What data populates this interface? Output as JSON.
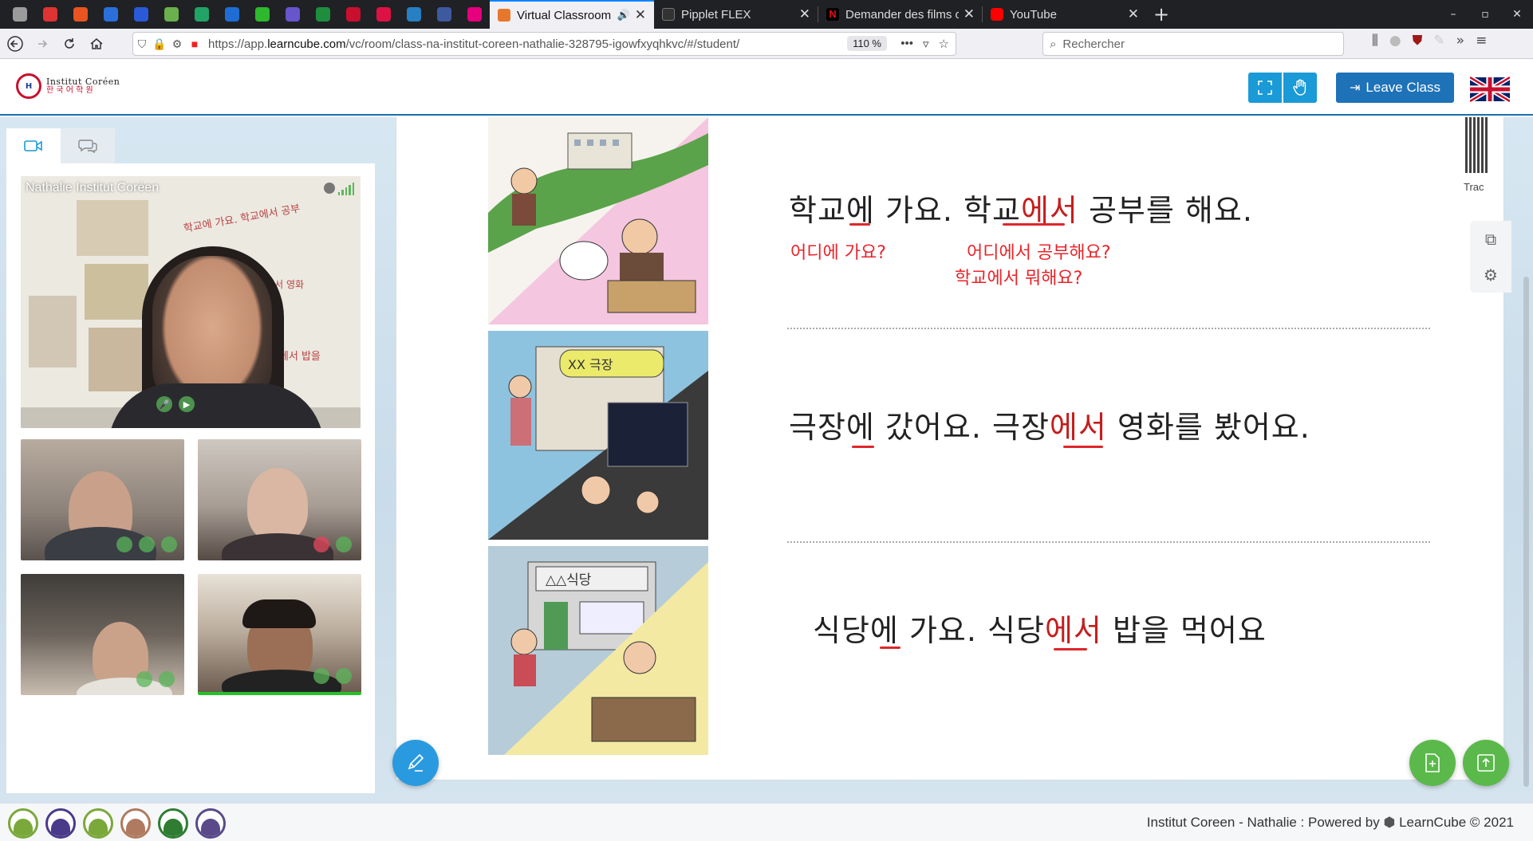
{
  "browser": {
    "tabs": [
      {
        "title": "Virtual Classroom | Le",
        "active": true,
        "favicon_color": "#e8772e"
      },
      {
        "title": "Pipplet FLEX",
        "active": false,
        "favicon_color": "#333333"
      },
      {
        "title": "Demander des films ou d",
        "active": false,
        "favicon_color": "#e50914"
      },
      {
        "title": "YouTube",
        "active": false,
        "favicon_color": "#ff0000"
      }
    ],
    "pinned_icons": [
      "#9b9b9b",
      "#d33",
      "#e95420",
      "#2a6fdb",
      "#2a5ad8",
      "#6ab04c",
      "#21a366",
      "#1f6dd4",
      "#2eb82e",
      "#6655cc",
      "#1e8e3e",
      "#c8102e",
      "#d14",
      "#2680c2",
      "#3d5a9e",
      "#e6007e"
    ],
    "url_prefix": "https://app.",
    "url_domain": "learncube.com",
    "url_path": "/vc/room/class-na-institut-coreen-nathalie-328795-igowfxyqhkvc/#/student/",
    "zoom": "110 %",
    "search_placeholder": "Rechercher",
    "new_tab": "+"
  },
  "header": {
    "logo_title": "Institut Coréen",
    "logo_sub": "한 국 어 학 원",
    "leave_label": "Leave Class"
  },
  "participants": {
    "main_name": "Nathalie Institut Coréen"
  },
  "board": {
    "sentence1": {
      "a": "학교에 가요. 학교",
      "hl": "에서",
      "b": " 공부를 해요."
    },
    "q1": "어디에 가요?",
    "q2": "어디에서 공부해요?",
    "q3": "학교에서 뭐해요?",
    "sentence2": {
      "a": "극장에 갔어요. 극장",
      "hl": "에서",
      "b": " 영화를 봤어요."
    },
    "sentence3": {
      "a": "식당에 가요. 식당",
      "hl": "에서",
      "b": " 밥을 먹어요"
    },
    "trac_label": "Trac",
    "sign1": "XX 극장",
    "sign2": "△△식당"
  },
  "footer": {
    "text": "Institut Coreen - Nathalie : Powered by",
    "brand": "LearnCube © 2021",
    "avatar_colors": [
      "#7aa83a",
      "#4a3a8a",
      "#7aa83a",
      "#b07a60",
      "#2e7d32",
      "#5a4a8a"
    ]
  },
  "colors": {
    "accent": "#1a9ad6",
    "leave_button": "#1d72b8",
    "highlight_red": "#e8242a",
    "green_button": "#5ab94a"
  }
}
